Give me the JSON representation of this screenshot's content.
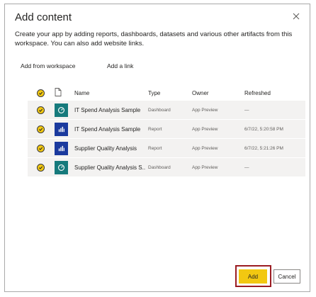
{
  "dialog": {
    "title": "Add content",
    "description": "Create your app by adding reports, dashboards, datasets and various other artifacts from this workspace. You can also add website links.",
    "close_icon": "close-icon"
  },
  "tabs": [
    {
      "label": "Add from workspace",
      "active": true
    },
    {
      "label": "Add a link",
      "active": false
    }
  ],
  "table": {
    "headers": {
      "name": "Name",
      "type": "Type",
      "owner": "Owner",
      "refreshed": "Refreshed"
    },
    "rows": [
      {
        "name": "IT Spend Analysis Sample",
        "type": "Dashboard",
        "owner": "App Preview",
        "refreshed": "—",
        "icon": "dashboard-icon",
        "selected": true
      },
      {
        "name": "IT Spend Analysis Sample",
        "type": "Report",
        "owner": "App Preview",
        "refreshed": "6/7/22, 5:20:58 PM",
        "icon": "report-icon",
        "selected": true
      },
      {
        "name": "Supplier Quality Analysis",
        "type": "Report",
        "owner": "App Preview",
        "refreshed": "6/7/22, 5:21:26 PM",
        "icon": "report-icon",
        "selected": true
      },
      {
        "name": "Supplier Quality Analysis S...",
        "type": "Dashboard",
        "owner": "App Preview",
        "refreshed": "—",
        "icon": "dashboard-icon",
        "selected": true
      }
    ]
  },
  "buttons": {
    "add": "Add",
    "cancel": "Cancel"
  },
  "colors": {
    "accent": "#f2c811",
    "highlight_border": "#9b1c22",
    "dashboard_icon_bg": "#167a7c",
    "report_icon_bg": "#1b3a9e",
    "row_bg": "#f3f2f1"
  }
}
